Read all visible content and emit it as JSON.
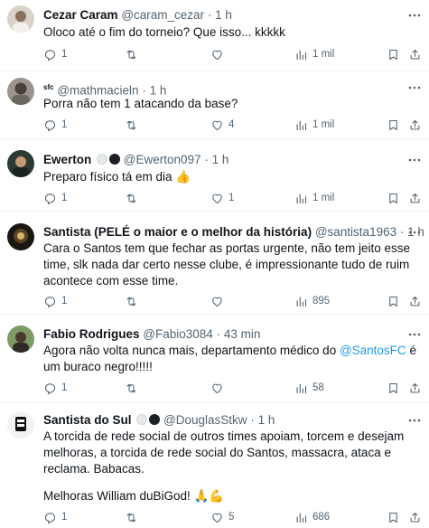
{
  "tweets": [
    {
      "name": "Cezar Caram",
      "handle": "@caram_cezar",
      "time": "1 h",
      "badges": [],
      "text": [
        "Oloco até o fim do torneio? Que isso... kkkkk"
      ],
      "replies": "1",
      "retweets": "",
      "likes": "",
      "views": "1 mil",
      "avatar_color": "#c9c2b8"
    },
    {
      "name_prefix": "sfc",
      "name": "",
      "handle": "@mathmacieln",
      "time": "1 h",
      "badges": [],
      "text": [
        "Porra não tem 1 atacando da base?"
      ],
      "replies": "1",
      "retweets": "",
      "likes": "4",
      "views": "1 mil",
      "avatar_color": "#6b6560"
    },
    {
      "name": "Ewerton",
      "handle": "@Ewerton097",
      "time": "1 h",
      "badges": [
        "light",
        "dark"
      ],
      "text": [
        "Preparo físico tá em dia 👍"
      ],
      "replies": "1",
      "retweets": "",
      "likes": "1",
      "views": "1 mil",
      "avatar_color": "#2b3a33"
    },
    {
      "name": "Santista (PELÉ o maior e o melhor da história)",
      "handle": "@santista1963",
      "time": "1 h",
      "badges": [],
      "text": [
        "Cara o Santos tem que fechar as portas urgente, não tem jeito esse time, slk nada dar certo nesse clube, é impressionante tudo de ruim acontece com esse time."
      ],
      "replies": "1",
      "retweets": "",
      "likes": "",
      "views": "895",
      "avatar_color": "#3a2f1c"
    },
    {
      "name": "Fabio Rodrigues",
      "handle": "@Fabio3084",
      "time": "43 min",
      "badges": [],
      "text_before": "Agora não volta nunca mais, departamento médico do ",
      "mention": "@SantosFC",
      "text_after": " é um buraco negro!!!!!",
      "replies": "1",
      "retweets": "",
      "likes": "",
      "views": "58",
      "avatar_color": "#5d7a4a"
    },
    {
      "name": "Santista do Sul",
      "handle": "@DouglasStkw",
      "time": "1 h",
      "badges": [
        "light",
        "dark"
      ],
      "text": [
        "A torcida de rede social de outros times apoiam, torcem e desejam melhoras, a torcida de rede social do Santos, massacra, ataca e reclama. Babacas.",
        "Melhoras William duBiGod! 🙏💪"
      ],
      "replies": "1",
      "retweets": "",
      "likes": "5",
      "views": "686",
      "avatar_color": "#e9e9e9"
    }
  ]
}
